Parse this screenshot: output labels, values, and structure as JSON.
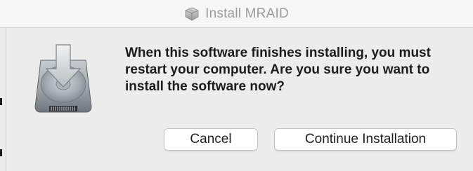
{
  "window": {
    "title": "Install MRAID",
    "title_icon": "package-icon"
  },
  "dialog": {
    "icon": "disk-download-icon",
    "message": "When this software finishes installing, you must restart your computer. Are you sure you want to install the software now?"
  },
  "buttons": {
    "cancel_label": "Cancel",
    "continue_label": "Continue Installation"
  },
  "colors": {
    "window_bg": "#ececec",
    "titlebar_bg": "#f6f6f6",
    "title_text": "#9c9c9c",
    "message_text": "#1c1c1c",
    "button_bg": "#ffffff"
  }
}
